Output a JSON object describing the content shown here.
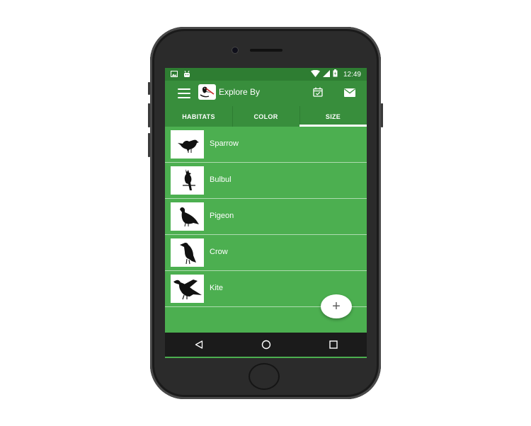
{
  "status_bar": {
    "time": "12:49",
    "left_icons": [
      "image-icon",
      "android-icon"
    ],
    "right_icons": [
      "wifi-icon",
      "signal-icon",
      "battery-icon"
    ]
  },
  "app_bar": {
    "title": "Explore By",
    "icons": [
      "menu-icon",
      "app-logo-icon",
      "calendar-icon",
      "mail-icon"
    ]
  },
  "tabs": [
    {
      "label": "HABITATS",
      "active": false
    },
    {
      "label": "COLOR",
      "active": false
    },
    {
      "label": "SIZE",
      "active": true
    }
  ],
  "birds": [
    {
      "name": "Sparrow",
      "icon": "sparrow-icon"
    },
    {
      "name": "Bulbul",
      "icon": "bulbul-icon"
    },
    {
      "name": "Pigeon",
      "icon": "pigeon-icon"
    },
    {
      "name": "Crow",
      "icon": "crow-icon"
    },
    {
      "name": "Kite",
      "icon": "kite-icon"
    }
  ],
  "fab": {
    "label": "+"
  },
  "nav_bar": {
    "icons": [
      "back-icon",
      "home-icon",
      "recents-icon"
    ]
  },
  "colors": {
    "primary": "#4caf50",
    "primary_dark": "#2e7d32",
    "app_bar": "#388e3c",
    "accent": "#ffffff",
    "phone_body": "#2b2b2b"
  }
}
